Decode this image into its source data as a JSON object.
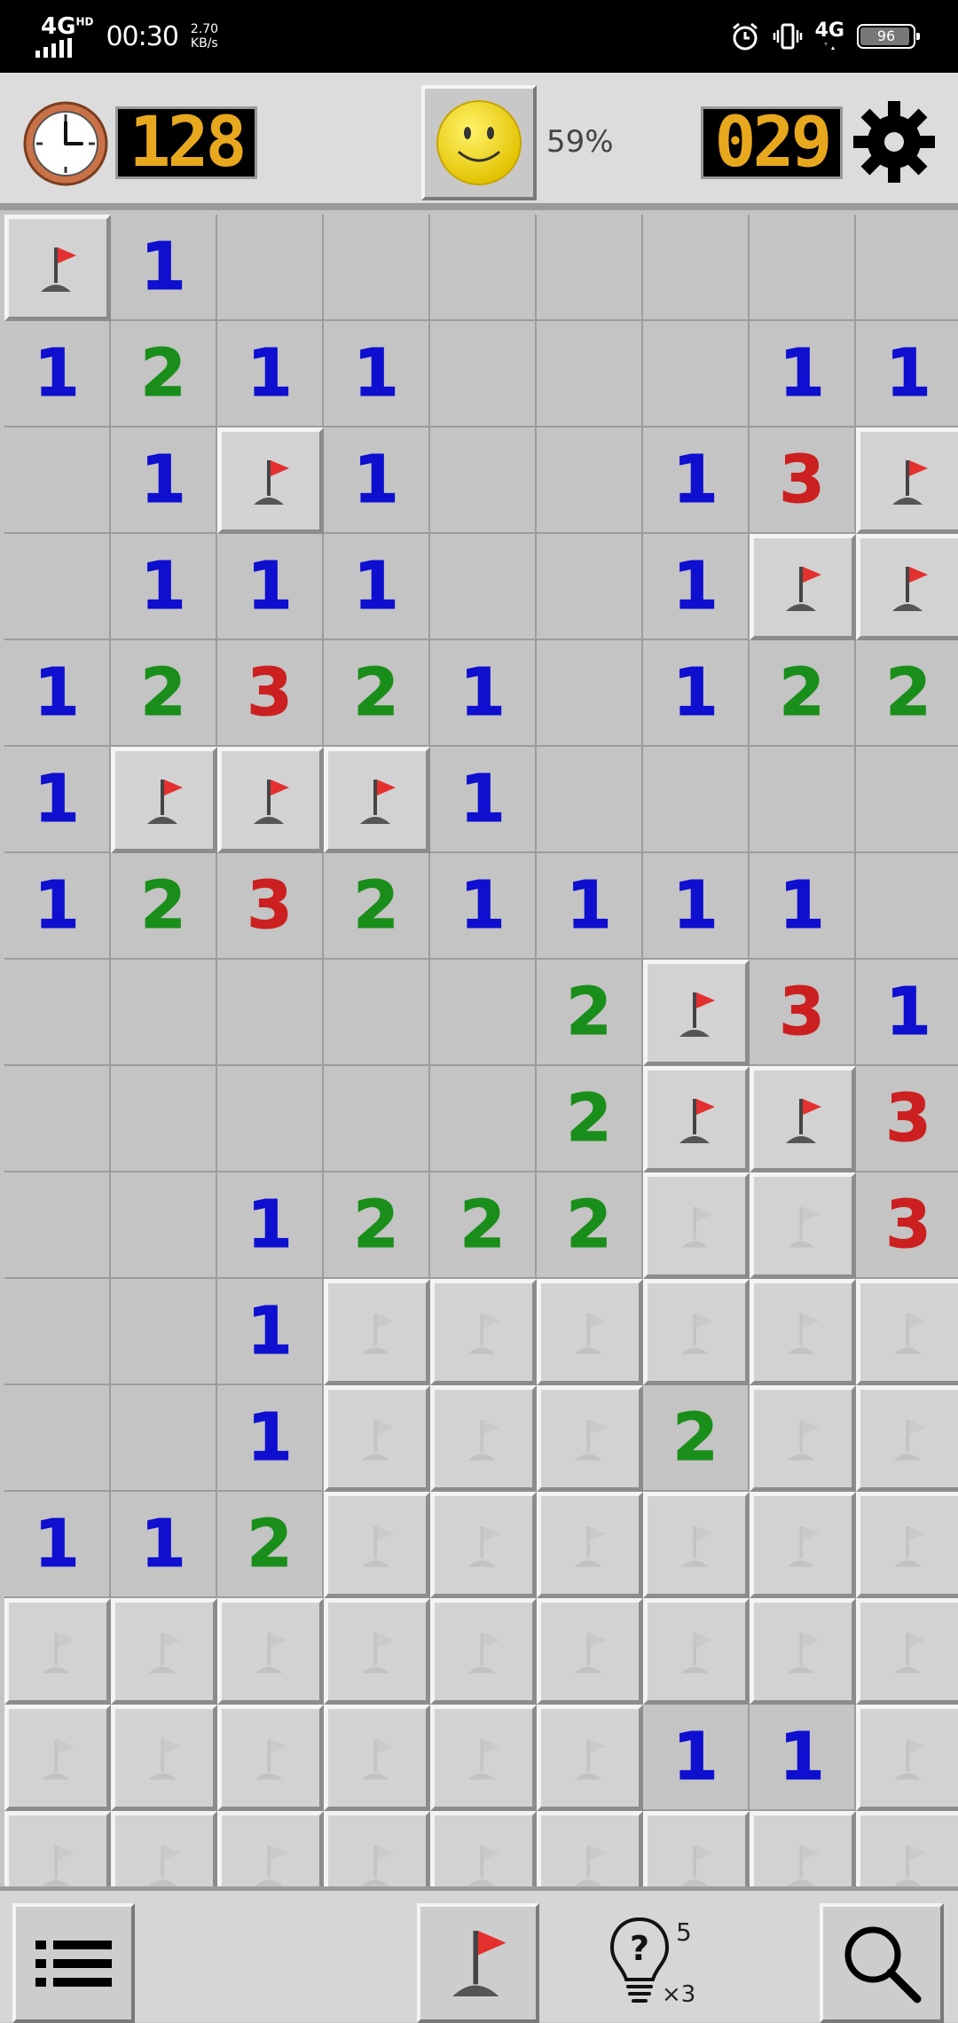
{
  "status_bar": {
    "network": "4G",
    "network_sup": "HD",
    "time": "00:30",
    "speed_value": "2.70",
    "speed_unit": "KB/s",
    "network_right": "4G",
    "battery": "96"
  },
  "header": {
    "timer": "128",
    "mines_left": "029",
    "progress": "59%"
  },
  "board": {
    "rows": [
      [
        "F",
        "1",
        "",
        "",
        "",
        "",
        "",
        "",
        ""
      ],
      [
        "1",
        "2",
        "1",
        "1",
        "",
        "",
        "",
        "1",
        "1"
      ],
      [
        "",
        "1",
        "F",
        "1",
        "",
        "",
        "1",
        "3",
        "F"
      ],
      [
        "",
        "1",
        "1",
        "1",
        "",
        "",
        "1",
        "F",
        "F"
      ],
      [
        "1",
        "2",
        "3",
        "2",
        "1",
        "",
        "1",
        "2",
        "2"
      ],
      [
        "1",
        "F",
        "F",
        "F",
        "1",
        "",
        "",
        "",
        ""
      ],
      [
        "1",
        "2",
        "3",
        "2",
        "1",
        "1",
        "1",
        "1",
        ""
      ],
      [
        "",
        "",
        "",
        "",
        "",
        "2",
        "F",
        "3",
        "1"
      ],
      [
        "",
        "",
        "",
        "",
        "",
        "2",
        "F",
        "F",
        "3"
      ],
      [
        "",
        "",
        "1",
        "2",
        "2",
        "2",
        "C",
        "C",
        "3"
      ],
      [
        "",
        "",
        "1",
        "C",
        "C",
        "C",
        "C",
        "C",
        "C"
      ],
      [
        "",
        "",
        "1",
        "C",
        "C",
        "C",
        "2",
        "C",
        "C"
      ],
      [
        "1",
        "1",
        "2",
        "C",
        "C",
        "C",
        "C",
        "C",
        "C"
      ],
      [
        "C",
        "C",
        "C",
        "C",
        "C",
        "C",
        "C",
        "C",
        "C"
      ],
      [
        "C",
        "C",
        "C",
        "C",
        "C",
        "C",
        "1",
        "1",
        "C"
      ],
      [
        "C",
        "C",
        "C",
        "C",
        "C",
        "C",
        "C",
        "C",
        "C"
      ]
    ]
  },
  "bottom_bar": {
    "hint_count": "5",
    "hint_multiplier": "×3"
  }
}
